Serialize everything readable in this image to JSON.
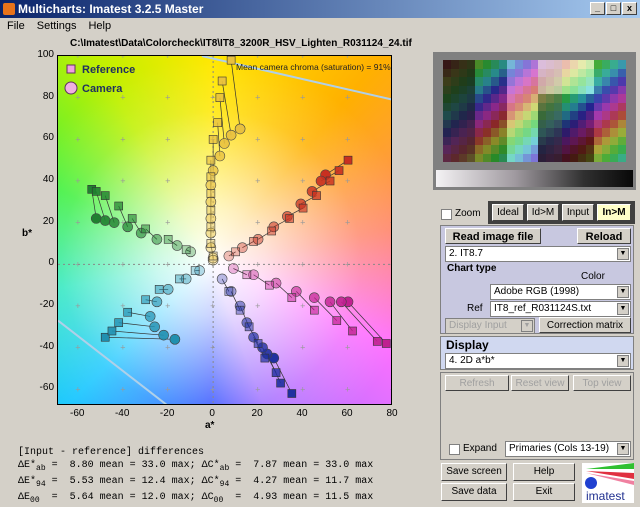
{
  "window": {
    "title": "Multicharts: Imatest 3.2.5  Master",
    "min": "_",
    "max": "□",
    "close": "x"
  },
  "menu": [
    "File",
    "Settings",
    "Help"
  ],
  "file_path": "C:\\Imatest\\Data\\Colorcheck\\IT8\\IT8_3200R_HSV_Lighten_R031124_24.tif",
  "chart_data": {
    "type": "scatter",
    "xlabel": "a*",
    "ylabel": "b*",
    "xlim": [
      -69,
      80
    ],
    "ylim": [
      -68,
      100
    ],
    "xticks": [
      -60,
      -40,
      -20,
      0,
      20,
      40,
      60,
      80
    ],
    "yticks": [
      100,
      80,
      60,
      40,
      20,
      0,
      -20,
      -40,
      -60
    ],
    "annotation": "Mean camera chroma (saturation) = 91%",
    "legend": {
      "placement": "top-left",
      "entries": [
        "Reference",
        "Camera"
      ]
    },
    "groups": [
      {
        "color": "#e8c040",
        "ref": [
          [
            8,
            98
          ],
          [
            4,
            88
          ],
          [
            3,
            80
          ],
          [
            2,
            68
          ],
          [
            0,
            60
          ],
          [
            -1,
            50
          ],
          [
            -1,
            42
          ],
          [
            -1,
            34
          ],
          [
            -1,
            26
          ],
          [
            -1,
            18
          ],
          [
            -1,
            10
          ],
          [
            0,
            4
          ]
        ],
        "cam": [
          [
            12,
            65
          ],
          [
            8,
            62
          ],
          [
            5,
            58
          ],
          [
            3,
            52
          ],
          [
            0,
            45
          ],
          [
            -1,
            38
          ],
          [
            -1,
            30
          ],
          [
            -1,
            22
          ],
          [
            -1,
            15
          ],
          [
            -1,
            8
          ],
          [
            0,
            3
          ],
          [
            0,
            2
          ]
        ]
      },
      {
        "color": "#c83020",
        "ref": [
          [
            60,
            50
          ],
          [
            56,
            45
          ],
          [
            52,
            40
          ],
          [
            46,
            33
          ],
          [
            40,
            27
          ],
          [
            34,
            22
          ],
          [
            26,
            16
          ],
          [
            18,
            11
          ],
          [
            10,
            6
          ]
        ],
        "cam": [
          [
            50,
            43
          ],
          [
            48,
            40
          ],
          [
            44,
            35
          ],
          [
            39,
            29
          ],
          [
            33,
            23
          ],
          [
            27,
            18
          ],
          [
            20,
            12
          ],
          [
            13,
            8
          ],
          [
            7,
            4
          ]
        ]
      },
      {
        "color": "#208030",
        "ref": [
          [
            -54,
            36
          ],
          [
            -52,
            35
          ],
          [
            -48,
            33
          ],
          [
            -42,
            28
          ],
          [
            -36,
            22
          ],
          [
            -30,
            17
          ],
          [
            -20,
            12
          ],
          [
            -12,
            7
          ]
        ],
        "cam": [
          [
            -52,
            22
          ],
          [
            -48,
            21
          ],
          [
            -44,
            20
          ],
          [
            -38,
            18
          ],
          [
            -32,
            15
          ],
          [
            -25,
            12
          ],
          [
            -16,
            9
          ],
          [
            -10,
            6
          ]
        ]
      },
      {
        "color": "#2090b0",
        "ref": [
          [
            -48,
            -35
          ],
          [
            -45,
            -32
          ],
          [
            -42,
            -28
          ],
          [
            -38,
            -23
          ],
          [
            -30,
            -17
          ],
          [
            -24,
            -12
          ],
          [
            -15,
            -7
          ],
          [
            -8,
            -3
          ]
        ],
        "cam": [
          [
            -17,
            -36
          ],
          [
            -22,
            -34
          ],
          [
            -26,
            -30
          ],
          [
            -28,
            -25
          ],
          [
            -25,
            -18
          ],
          [
            -20,
            -12
          ],
          [
            -12,
            -7
          ],
          [
            -6,
            -3
          ]
        ]
      },
      {
        "color": "#2030a0",
        "ref": [
          [
            35,
            -62
          ],
          [
            30,
            -57
          ],
          [
            28,
            -52
          ],
          [
            23,
            -45
          ],
          [
            20,
            -38
          ],
          [
            16,
            -30
          ],
          [
            12,
            -22
          ],
          [
            7,
            -13
          ]
        ],
        "cam": [
          [
            27,
            -45
          ],
          [
            24,
            -43
          ],
          [
            22,
            -40
          ],
          [
            18,
            -35
          ],
          [
            15,
            -28
          ],
          [
            12,
            -20
          ],
          [
            8,
            -13
          ],
          [
            4,
            -7
          ]
        ]
      },
      {
        "color": "#c02090",
        "ref": [
          [
            77,
            -38
          ],
          [
            73,
            -37
          ],
          [
            62,
            -32
          ],
          [
            55,
            -27
          ],
          [
            45,
            -22
          ],
          [
            35,
            -16
          ],
          [
            25,
            -10
          ],
          [
            15,
            -5
          ]
        ],
        "cam": [
          [
            60,
            -18
          ],
          [
            57,
            -18
          ],
          [
            52,
            -18
          ],
          [
            45,
            -16
          ],
          [
            37,
            -13
          ],
          [
            28,
            -9
          ],
          [
            18,
            -5
          ],
          [
            9,
            -2
          ]
        ]
      }
    ]
  },
  "stats": {
    "header": "[Input - reference] differences",
    "rows": [
      {
        "a": "ΔE*",
        "as": "ab",
        "av": " =  8.80 mean = 33.0 max; ",
        "b": "ΔC*",
        "bs": "ab",
        "bv": " =  7.87 mean = 33.0 max"
      },
      {
        "a": "ΔE*",
        "as": "94",
        "av": " =  5.53 mean = 12.4 max; ",
        "b": "ΔC*",
        "bs": "94",
        "bv": " =  4.27 mean = 11.7 max"
      },
      {
        "a": "ΔE",
        "as": "00",
        "av": "  =  5.64 mean = 12.0 max; ",
        "b": "ΔC",
        "bs": "00",
        "bv": "  =  4.93 mean = 11.5 max"
      }
    ]
  },
  "controls": {
    "zoom_label": "Zoom",
    "zoom_checked": false,
    "view_tabs": [
      "Ideal",
      "Id>M",
      "Input",
      "In>M"
    ],
    "active_tab": "In>M",
    "read_image": "Read image file",
    "reload": "Reload",
    "chart_select": "2. IT8.7",
    "chart_type": "Chart type",
    "color_space_label": "Color space",
    "color_space": "Adobe RGB (1998)",
    "ref_label": "Ref",
    "ref_file": "IT8_ref_R031124S.txt",
    "display_input": "Display Input",
    "correction_matrix": "Correction matrix",
    "display_label": "Display",
    "display_select": "4.  2D a*b*",
    "refresh": "Refresh",
    "reset_view": "Reset view",
    "top_view": "Top view",
    "expand_label": "Expand",
    "expand_checked": false,
    "patch_select": "Primaries (Cols 13-19)",
    "save_screen": "Save screen",
    "help": "Help",
    "save_data": "Save data",
    "exit": "Exit",
    "logo_text": "imatest"
  }
}
